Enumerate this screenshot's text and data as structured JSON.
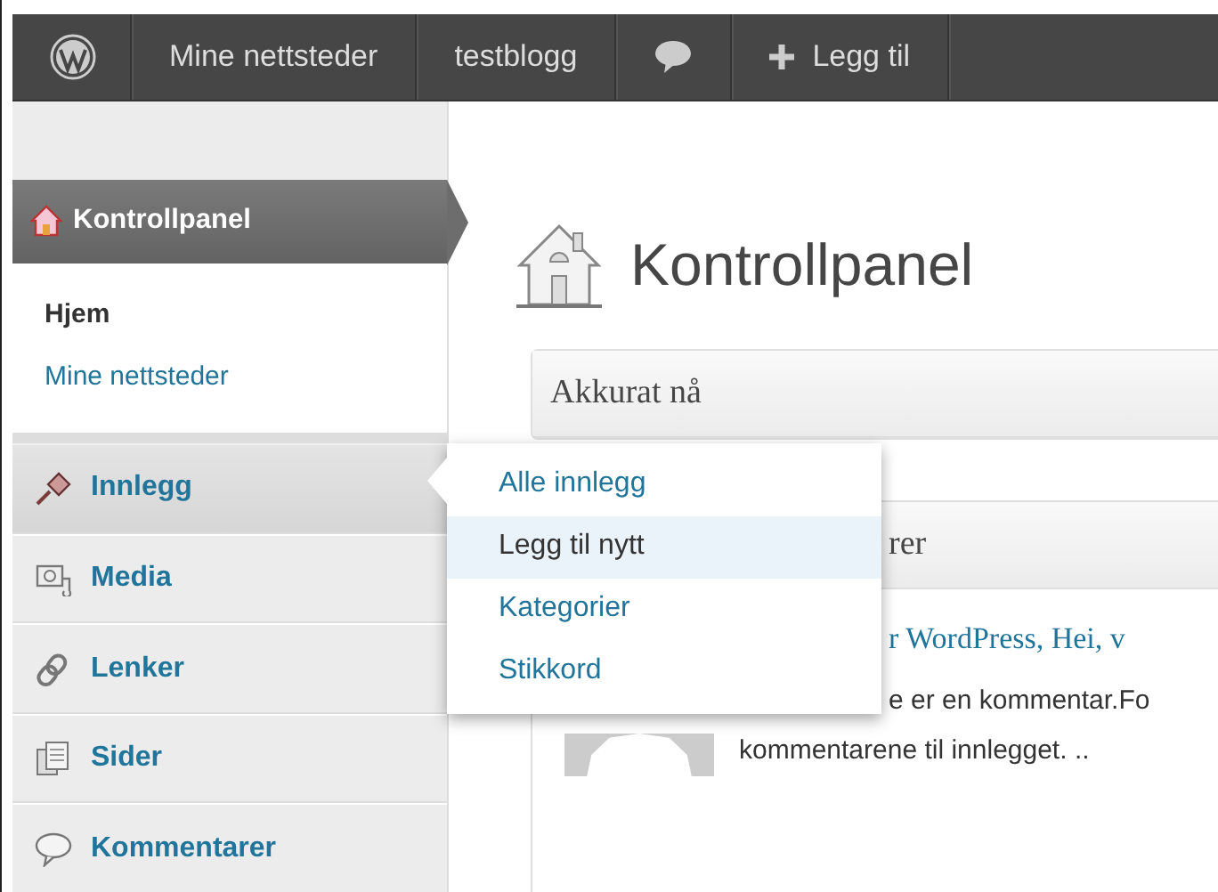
{
  "admin_bar": {
    "items": [
      {
        "kind": "logo"
      },
      {
        "kind": "text",
        "label": "Mine nettsteder"
      },
      {
        "kind": "text",
        "label": "testblogg"
      },
      {
        "kind": "comments"
      },
      {
        "kind": "add",
        "label": "Legg til"
      }
    ]
  },
  "sidebar": {
    "active": {
      "label": "Kontrollpanel",
      "submenu": [
        {
          "label": "Hjem",
          "selected": true
        },
        {
          "label": "Mine nettsteder",
          "selected": false
        }
      ]
    },
    "items": [
      {
        "label": "Innlegg",
        "hover": true
      },
      {
        "label": "Media",
        "hover": false
      },
      {
        "label": "Lenker",
        "hover": false
      },
      {
        "label": "Sider",
        "hover": false
      },
      {
        "label": "Kommentarer",
        "hover": false
      }
    ]
  },
  "flyout": {
    "items": [
      {
        "label": "Alle innlegg",
        "selected": false
      },
      {
        "label": "Legg til nytt",
        "selected": true
      },
      {
        "label": "Kategorier",
        "selected": false
      },
      {
        "label": "Stikkord",
        "selected": false
      }
    ]
  },
  "page": {
    "title": "Kontrollpanel",
    "boxes": [
      {
        "title": "Akkurat nå"
      },
      {
        "title": "rer",
        "comment": {
          "author": "r WordPress, Hei, v",
          "lines": [
            "e er en kommentar.Fo",
            "kommentarene til innlegget. .."
          ]
        }
      }
    ]
  }
}
